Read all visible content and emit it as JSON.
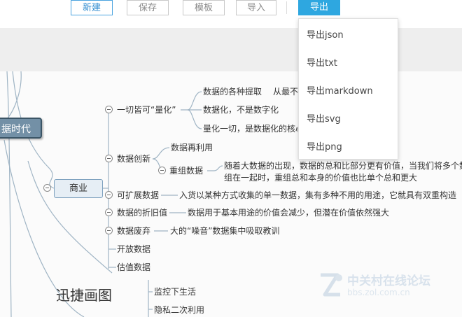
{
  "toolbar": {
    "new_label": "新建",
    "save_label": "保存",
    "template_label": "模板",
    "import_label": "导入",
    "export_label": "导出"
  },
  "export_menu": [
    "导出json",
    "导出txt",
    "导出markdown",
    "导出svg",
    "导出png"
  ],
  "mindmap": {
    "root": "据时代",
    "hidden_text": "从最不",
    "business": "商业",
    "quantify": {
      "label": "一切皆可“量化”",
      "children": [
        "数据的各种提取",
        "数据化，不是数字化",
        "量化一切，是数据化的核心"
      ]
    },
    "innovation": {
      "label": "数据创新",
      "reuse": "数据再利用",
      "recombine": "重组数据",
      "recombine_desc_1": "随着大数据的出现，数据的总和比部分更有价值，当我们将多个数",
      "recombine_desc_2": "组在一起时，重组总和本身的价值也比单个总和更大"
    },
    "extensible": {
      "label": "可扩展数据",
      "desc": "入货以某种方式收集的单一数据，集有多种不用的用途，它就具有双重构造"
    },
    "depreciation": {
      "label": "数据的折旧值",
      "desc": "数据用于基本用途的价值会减少，但潜在价值依然强大"
    },
    "waste": {
      "label": "数据废弃",
      "desc": "大的“噪音”数据集中吸取教训"
    },
    "open": "开放数据",
    "valuation": "估值数据",
    "monitor": "监控下生活",
    "privacy": "隐私二次利用"
  },
  "brand": "迅捷画图",
  "watermark": {
    "main": "中关村在线论坛",
    "sub": "bbs.zol.com.cn"
  },
  "colors": {
    "accent": "#2ea7e0",
    "root_fill": "#7390a6",
    "line": "#9fb4c4"
  }
}
